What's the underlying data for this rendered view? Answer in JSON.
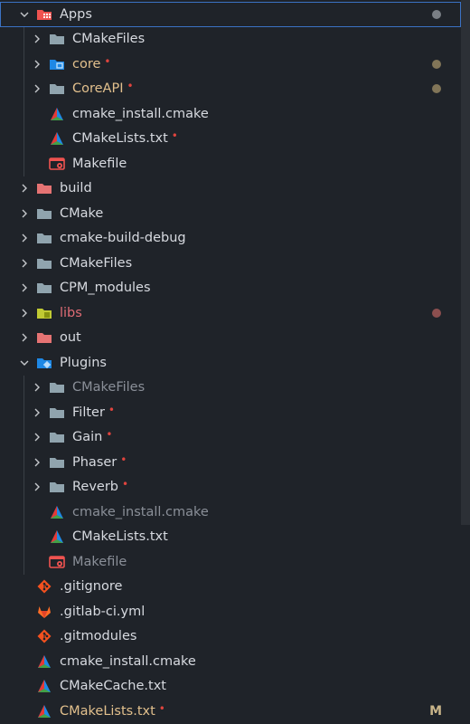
{
  "explorer": {
    "rows": [
      {
        "label": "Apps",
        "icon": "apps-folder-icon",
        "chevron": "down",
        "status": "grey",
        "selected": true,
        "style": ""
      },
      {
        "label": "CMakeFiles",
        "icon": "folder-icon",
        "chevron": "right",
        "style": ""
      },
      {
        "label": "core",
        "icon": "core-folder-icon",
        "chevron": "right",
        "style": "modified",
        "dot": "•",
        "status": "olive"
      },
      {
        "label": "CoreAPI",
        "icon": "folder-icon",
        "chevron": "right",
        "style": "modified",
        "dot": "•",
        "status": "olive"
      },
      {
        "label": "cmake_install.cmake",
        "icon": "cmake-icon",
        "chevron": "none",
        "style": ""
      },
      {
        "label": "CMakeLists.txt",
        "icon": "cmake-icon",
        "chevron": "none",
        "style": "",
        "dot": "•"
      },
      {
        "label": "Makefile",
        "icon": "makefile-icon",
        "chevron": "none",
        "style": ""
      },
      {
        "label": "build",
        "icon": "red-folder-icon",
        "chevron": "right",
        "style": ""
      },
      {
        "label": "CMake",
        "icon": "folder-icon",
        "chevron": "right",
        "style": ""
      },
      {
        "label": "cmake-build-debug",
        "icon": "folder-icon",
        "chevron": "right",
        "style": ""
      },
      {
        "label": "CMakeFiles",
        "icon": "folder-icon",
        "chevron": "right",
        "style": ""
      },
      {
        "label": "CPM_modules",
        "icon": "folder-icon",
        "chevron": "right",
        "style": ""
      },
      {
        "label": "libs",
        "icon": "libs-folder-icon",
        "chevron": "right",
        "style": "error",
        "status": "red"
      },
      {
        "label": "out",
        "icon": "red-folder-icon",
        "chevron": "right",
        "style": ""
      },
      {
        "label": "Plugins",
        "icon": "plugins-folder-icon",
        "chevron": "down",
        "style": ""
      },
      {
        "label": "CMakeFiles",
        "icon": "folder-icon",
        "chevron": "right",
        "style": "dim"
      },
      {
        "label": "Filter",
        "icon": "folder-icon",
        "chevron": "right",
        "style": "",
        "dot": "•"
      },
      {
        "label": "Gain",
        "icon": "folder-icon",
        "chevron": "right",
        "style": "",
        "dot": "•"
      },
      {
        "label": "Phaser",
        "icon": "folder-icon",
        "chevron": "right",
        "style": "",
        "dot": "•"
      },
      {
        "label": "Reverb",
        "icon": "folder-icon",
        "chevron": "right",
        "style": "",
        "dot": "•"
      },
      {
        "label": "cmake_install.cmake",
        "icon": "cmake-icon",
        "chevron": "none",
        "style": "dim"
      },
      {
        "label": "CMakeLists.txt",
        "icon": "cmake-icon",
        "chevron": "none",
        "style": ""
      },
      {
        "label": "Makefile",
        "icon": "makefile-icon",
        "chevron": "none",
        "style": "dim"
      },
      {
        "label": ".gitignore",
        "icon": "git-icon",
        "chevron": "none",
        "style": ""
      },
      {
        "label": ".gitlab-ci.yml",
        "icon": "gitlab-icon",
        "chevron": "none",
        "style": ""
      },
      {
        "label": ".gitmodules",
        "icon": "git-icon",
        "chevron": "none",
        "style": ""
      },
      {
        "label": "cmake_install.cmake",
        "icon": "cmake-icon",
        "chevron": "none",
        "style": ""
      },
      {
        "label": "CMakeCache.txt",
        "icon": "cmake-icon",
        "chevron": "none",
        "style": ""
      },
      {
        "label": "CMakeLists.txt",
        "icon": "cmake-icon",
        "chevron": "none",
        "style": "modified",
        "dot": "•",
        "statusLetter": "M"
      }
    ]
  },
  "colors": {
    "background": "#1f2329",
    "selection_border": "#3b72c4",
    "modified_text": "#e2c08d",
    "error_text": "#e06c75",
    "modified_dot": "#e0443e"
  }
}
